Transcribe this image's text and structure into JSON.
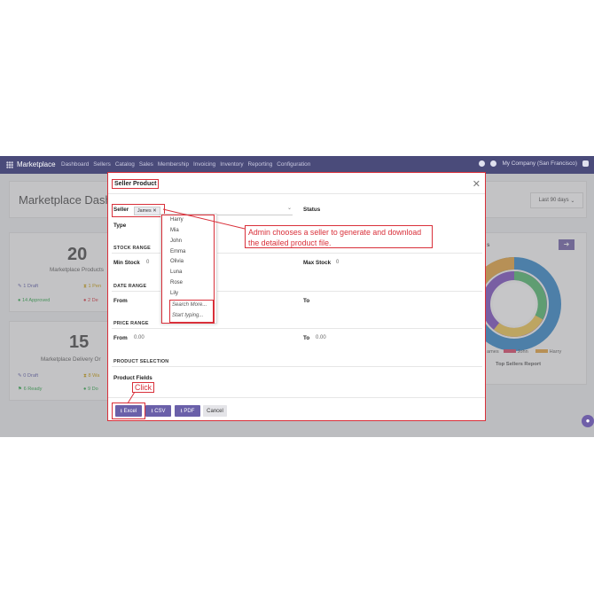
{
  "topbar": {
    "brand": "Marketplace",
    "menu": [
      "Dashboard",
      "Sellers",
      "Catalog",
      "Sales",
      "Membership",
      "Invoicing",
      "Inventory",
      "Reporting",
      "Configuration"
    ],
    "company": "My Company (San Francisco)"
  },
  "dashboard": {
    "title": "Marketplace Dash",
    "range_label": "Last 90 days",
    "products_count": "20",
    "products_label": "Marketplace Products",
    "draft_products": "1 Draft",
    "approved_products": "14 Approved",
    "pending_products": "1 Pen",
    "denied_products": "2 De",
    "delivery_count": "15",
    "delivery_label": "Marketplace Delivery Or",
    "draft_delivery": "0 Draft",
    "ready_delivery": "6 Ready",
    "waiting_delivery": "8 Wa",
    "done_delivery": "9 Do",
    "legend": [
      "ames",
      "John",
      "Harry"
    ],
    "chart_caption": "Top Sellers Report",
    "chart_letter": "s"
  },
  "modal": {
    "title": "Seller Product",
    "seller_label": "Seller",
    "seller_tag": "James ✕",
    "status_label": "Status",
    "type_label": "Type",
    "stock_range": "STOCK RANGE",
    "min_stock_label": "Min Stock",
    "min_stock_value": "0",
    "max_stock_label": "Max Stock",
    "max_stock_value": "0",
    "date_range": "DATE RANGE",
    "from_label": "From",
    "to_label": "To",
    "price_range": "PRICE RANGE",
    "price_from_label": "From",
    "price_from_value": "0.00",
    "price_to_label": "To",
    "price_to_value": "0.00",
    "product_selection": "PRODUCT SELECTION",
    "product_fields": "Product Fields",
    "dropdown": [
      "Harry",
      "Mia",
      "John",
      "Emma",
      "Olivia",
      "Luna",
      "Rose",
      "Lily"
    ],
    "search_more": "Search More...",
    "start_typing": "Start typing...",
    "buttons": {
      "excel": "Excel",
      "csv": "CSV",
      "pdf": "PDF",
      "cancel": "Cancel"
    }
  },
  "annotations": {
    "callout": "Admin chooses a seller to generate and download the detailed product file.",
    "click": "Click"
  }
}
